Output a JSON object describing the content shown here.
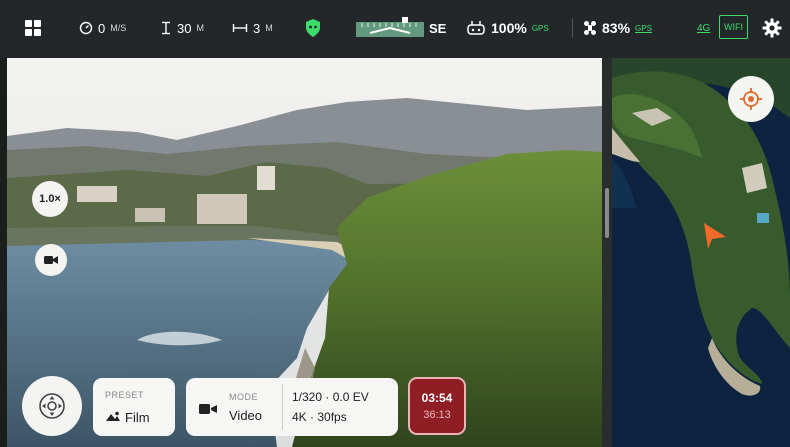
{
  "topbar": {
    "speed_value": "0",
    "speed_unit": "M/S",
    "altitude_value": "30",
    "altitude_unit": "M",
    "distance_value": "3",
    "distance_unit": "M",
    "heading": "SE",
    "controller_battery": "100%",
    "controller_gps": "GPS",
    "drone_battery": "83%",
    "drone_gps": "GPS",
    "network": "4G",
    "wifi": "WIFI"
  },
  "camera": {
    "zoom": "1.0×"
  },
  "bottom": {
    "preset_label": "PRESET",
    "preset_value": "Film",
    "mode_label": "MODE",
    "mode_value": "Video",
    "exposure": "1/320 · 0.0 EV",
    "resolution": "4K · 30fps",
    "time_main": "03:54",
    "time_sub": "36:13"
  },
  "colors": {
    "topbar_bg": "#23272a",
    "accent_green": "#3bdc6a",
    "record_red": "#8e1e24",
    "drone_marker": "#f06a2b"
  },
  "icons": [
    "grid-menu-icon",
    "speedometer-icon",
    "altitude-icon",
    "distance-icon",
    "shield-icon",
    "compass-strip",
    "controller-icon",
    "drone-icon",
    "settings-gear-icon",
    "locate-icon",
    "video-mode-icon",
    "joystick-icon",
    "drone-position-marker"
  ]
}
